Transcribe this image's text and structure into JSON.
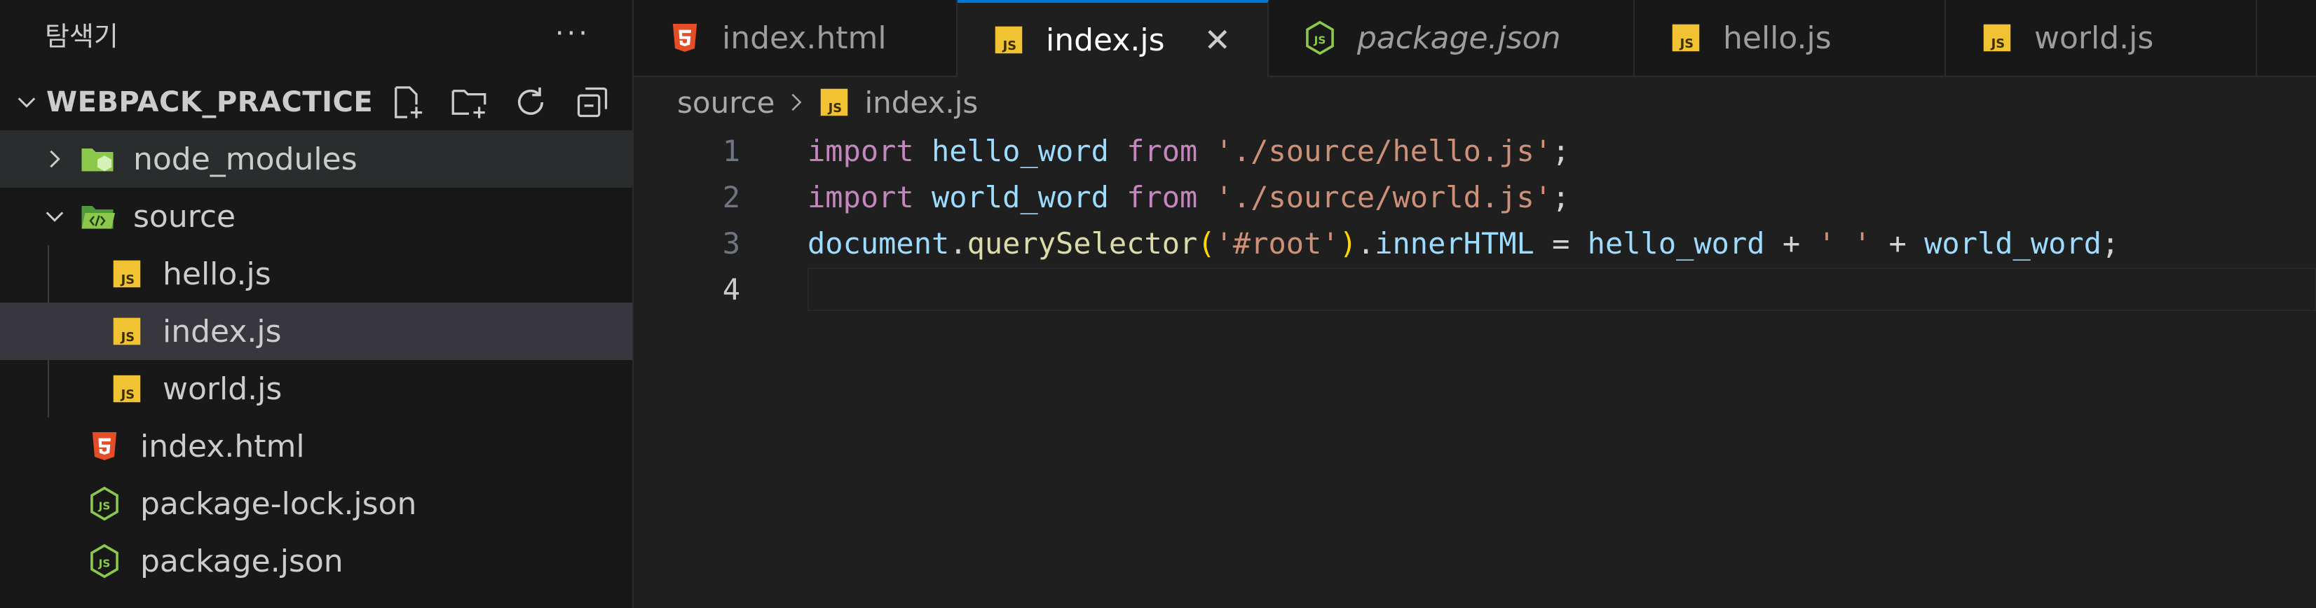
{
  "sidebar": {
    "title": "탐색기",
    "more": "···",
    "project": "WEBPACK_PRACTICE",
    "actions": [
      "new-file-icon",
      "new-folder-icon",
      "refresh-icon",
      "collapse-all-icon"
    ],
    "items": [
      {
        "label": "node_modules",
        "icon": "folder-node-icon",
        "indent": 0,
        "chevron": "right"
      },
      {
        "label": "source",
        "icon": "folder-source-icon",
        "indent": 0,
        "chevron": "down"
      },
      {
        "label": "hello.js",
        "icon": "js-file-icon",
        "indent": 1
      },
      {
        "label": "index.js",
        "icon": "js-file-icon",
        "indent": 1
      },
      {
        "label": "world.js",
        "icon": "js-file-icon",
        "indent": 1
      },
      {
        "label": "index.html",
        "icon": "html-file-icon",
        "indent": 0
      },
      {
        "label": "package-lock.json",
        "icon": "node-json-icon",
        "indent": 0
      },
      {
        "label": "package.json",
        "icon": "node-json-icon",
        "indent": 0
      }
    ]
  },
  "tabs": [
    {
      "label": "index.html",
      "icon": "html-file-icon"
    },
    {
      "label": "index.js",
      "icon": "js-file-icon",
      "active": true,
      "close": "✕"
    },
    {
      "label": "package.json",
      "icon": "node-json-icon",
      "italic": true
    },
    {
      "label": "hello.js",
      "icon": "js-file-icon"
    },
    {
      "label": "world.js",
      "icon": "js-file-icon"
    }
  ],
  "breadcrumb": {
    "folder": "source",
    "file": "index.js"
  },
  "code": {
    "line_numbers": [
      "1",
      "2",
      "3",
      "4"
    ],
    "line1": {
      "kw1": "import",
      "id": "hello_word",
      "kw2": "from",
      "str": "'./source/hello.js'",
      "end": ";"
    },
    "line2": {
      "kw1": "import",
      "id": "world_word",
      "kw2": "from",
      "str": "'./source/world.js'",
      "end": ";"
    },
    "line3": {
      "obj": "document",
      "dot1": ".",
      "fn": "querySelector",
      "p1": "(",
      "str1": "'#root'",
      "p2": ")",
      "dot2": ".",
      "prop": "innerHTML",
      "eq": " = ",
      "id1": "hello_word",
      "plus1": " + ",
      "str2": "' '",
      "plus2": " + ",
      "id2": "world_word",
      "end": ";"
    }
  },
  "colors": {
    "accent": "#0078d4",
    "js_icon": "#f1c232",
    "html_icon": "#e44d26",
    "node_icon": "#8cc84b"
  }
}
